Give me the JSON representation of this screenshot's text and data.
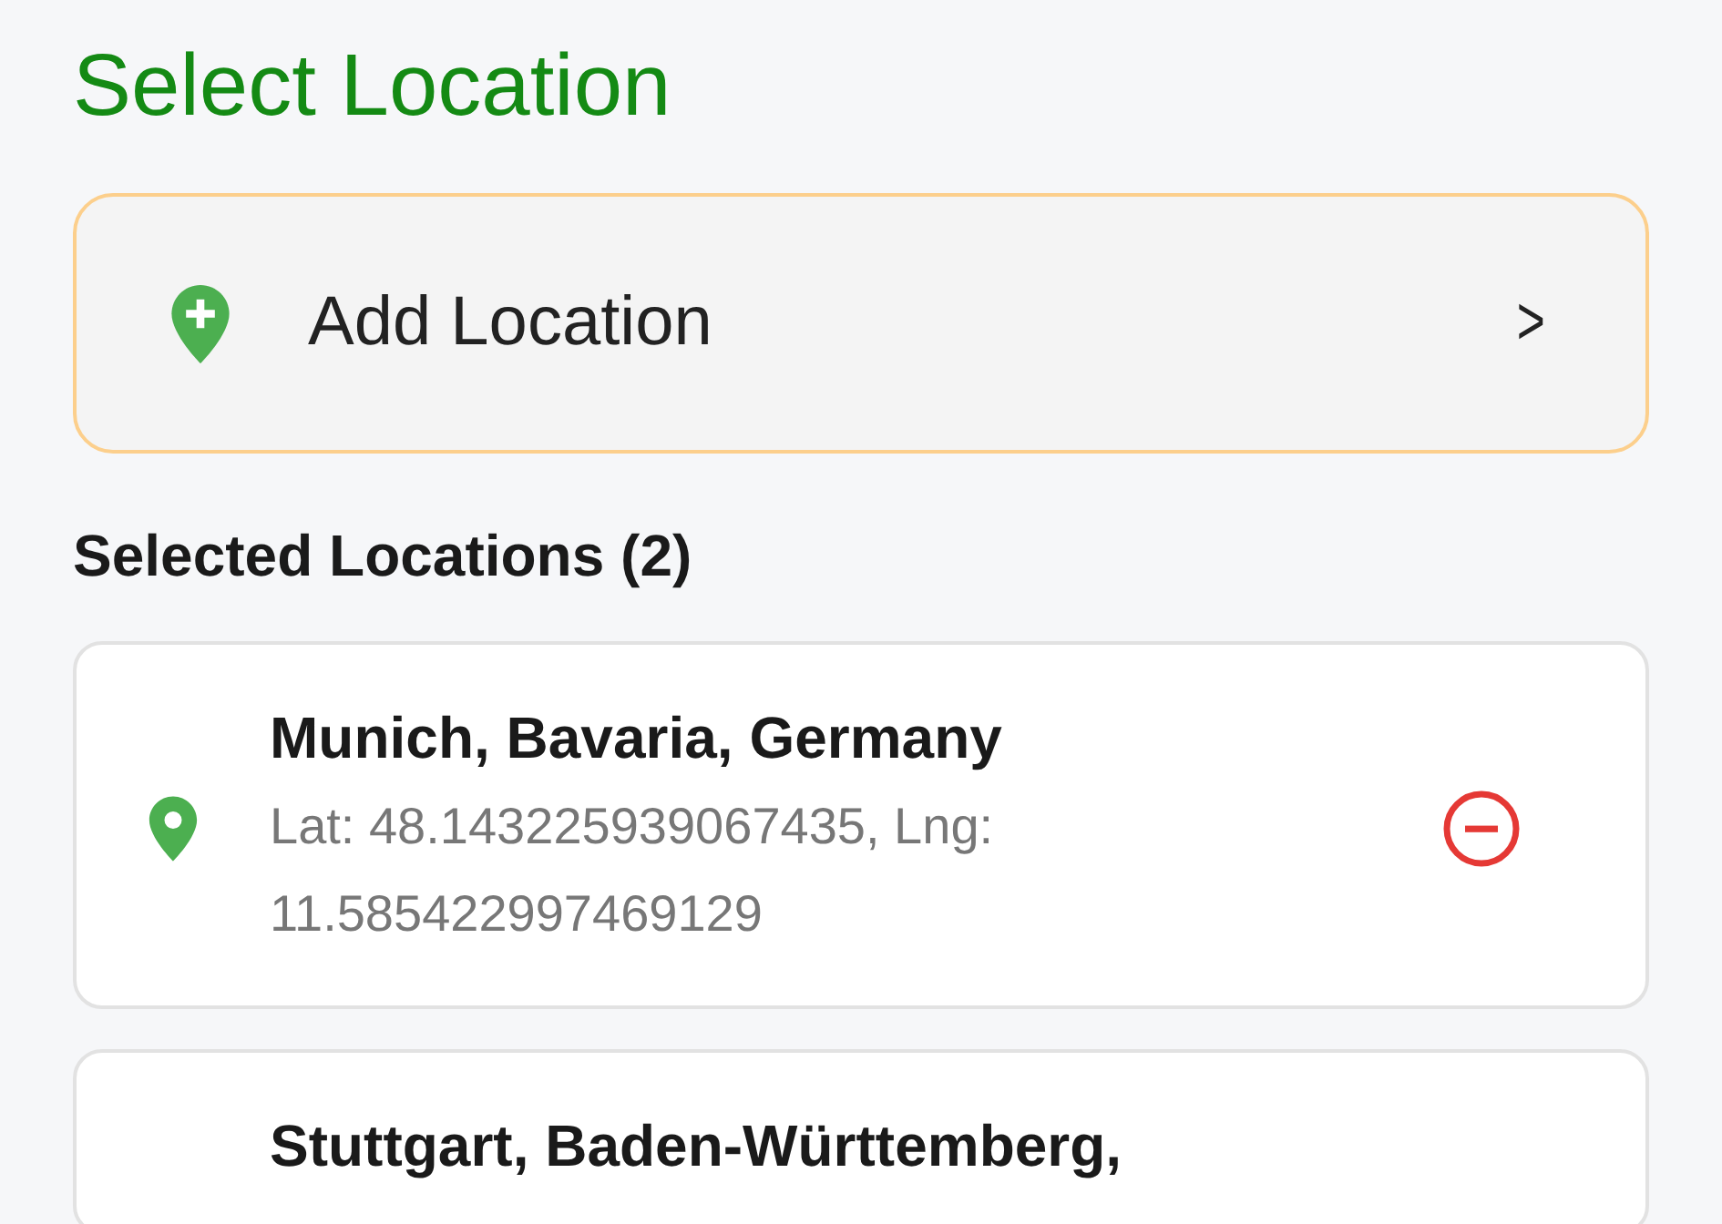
{
  "title": "Select Location",
  "add_button": {
    "label": "Add Location",
    "chevron": ">"
  },
  "section_heading": "Selected Locations (2)",
  "locations": [
    {
      "name": "Munich, Bavaria, Germany",
      "coords": "Lat: 48.143225939067435, Lng: 11.585422997469129"
    },
    {
      "name": "Stuttgart, Baden-Württemberg,"
    }
  ]
}
